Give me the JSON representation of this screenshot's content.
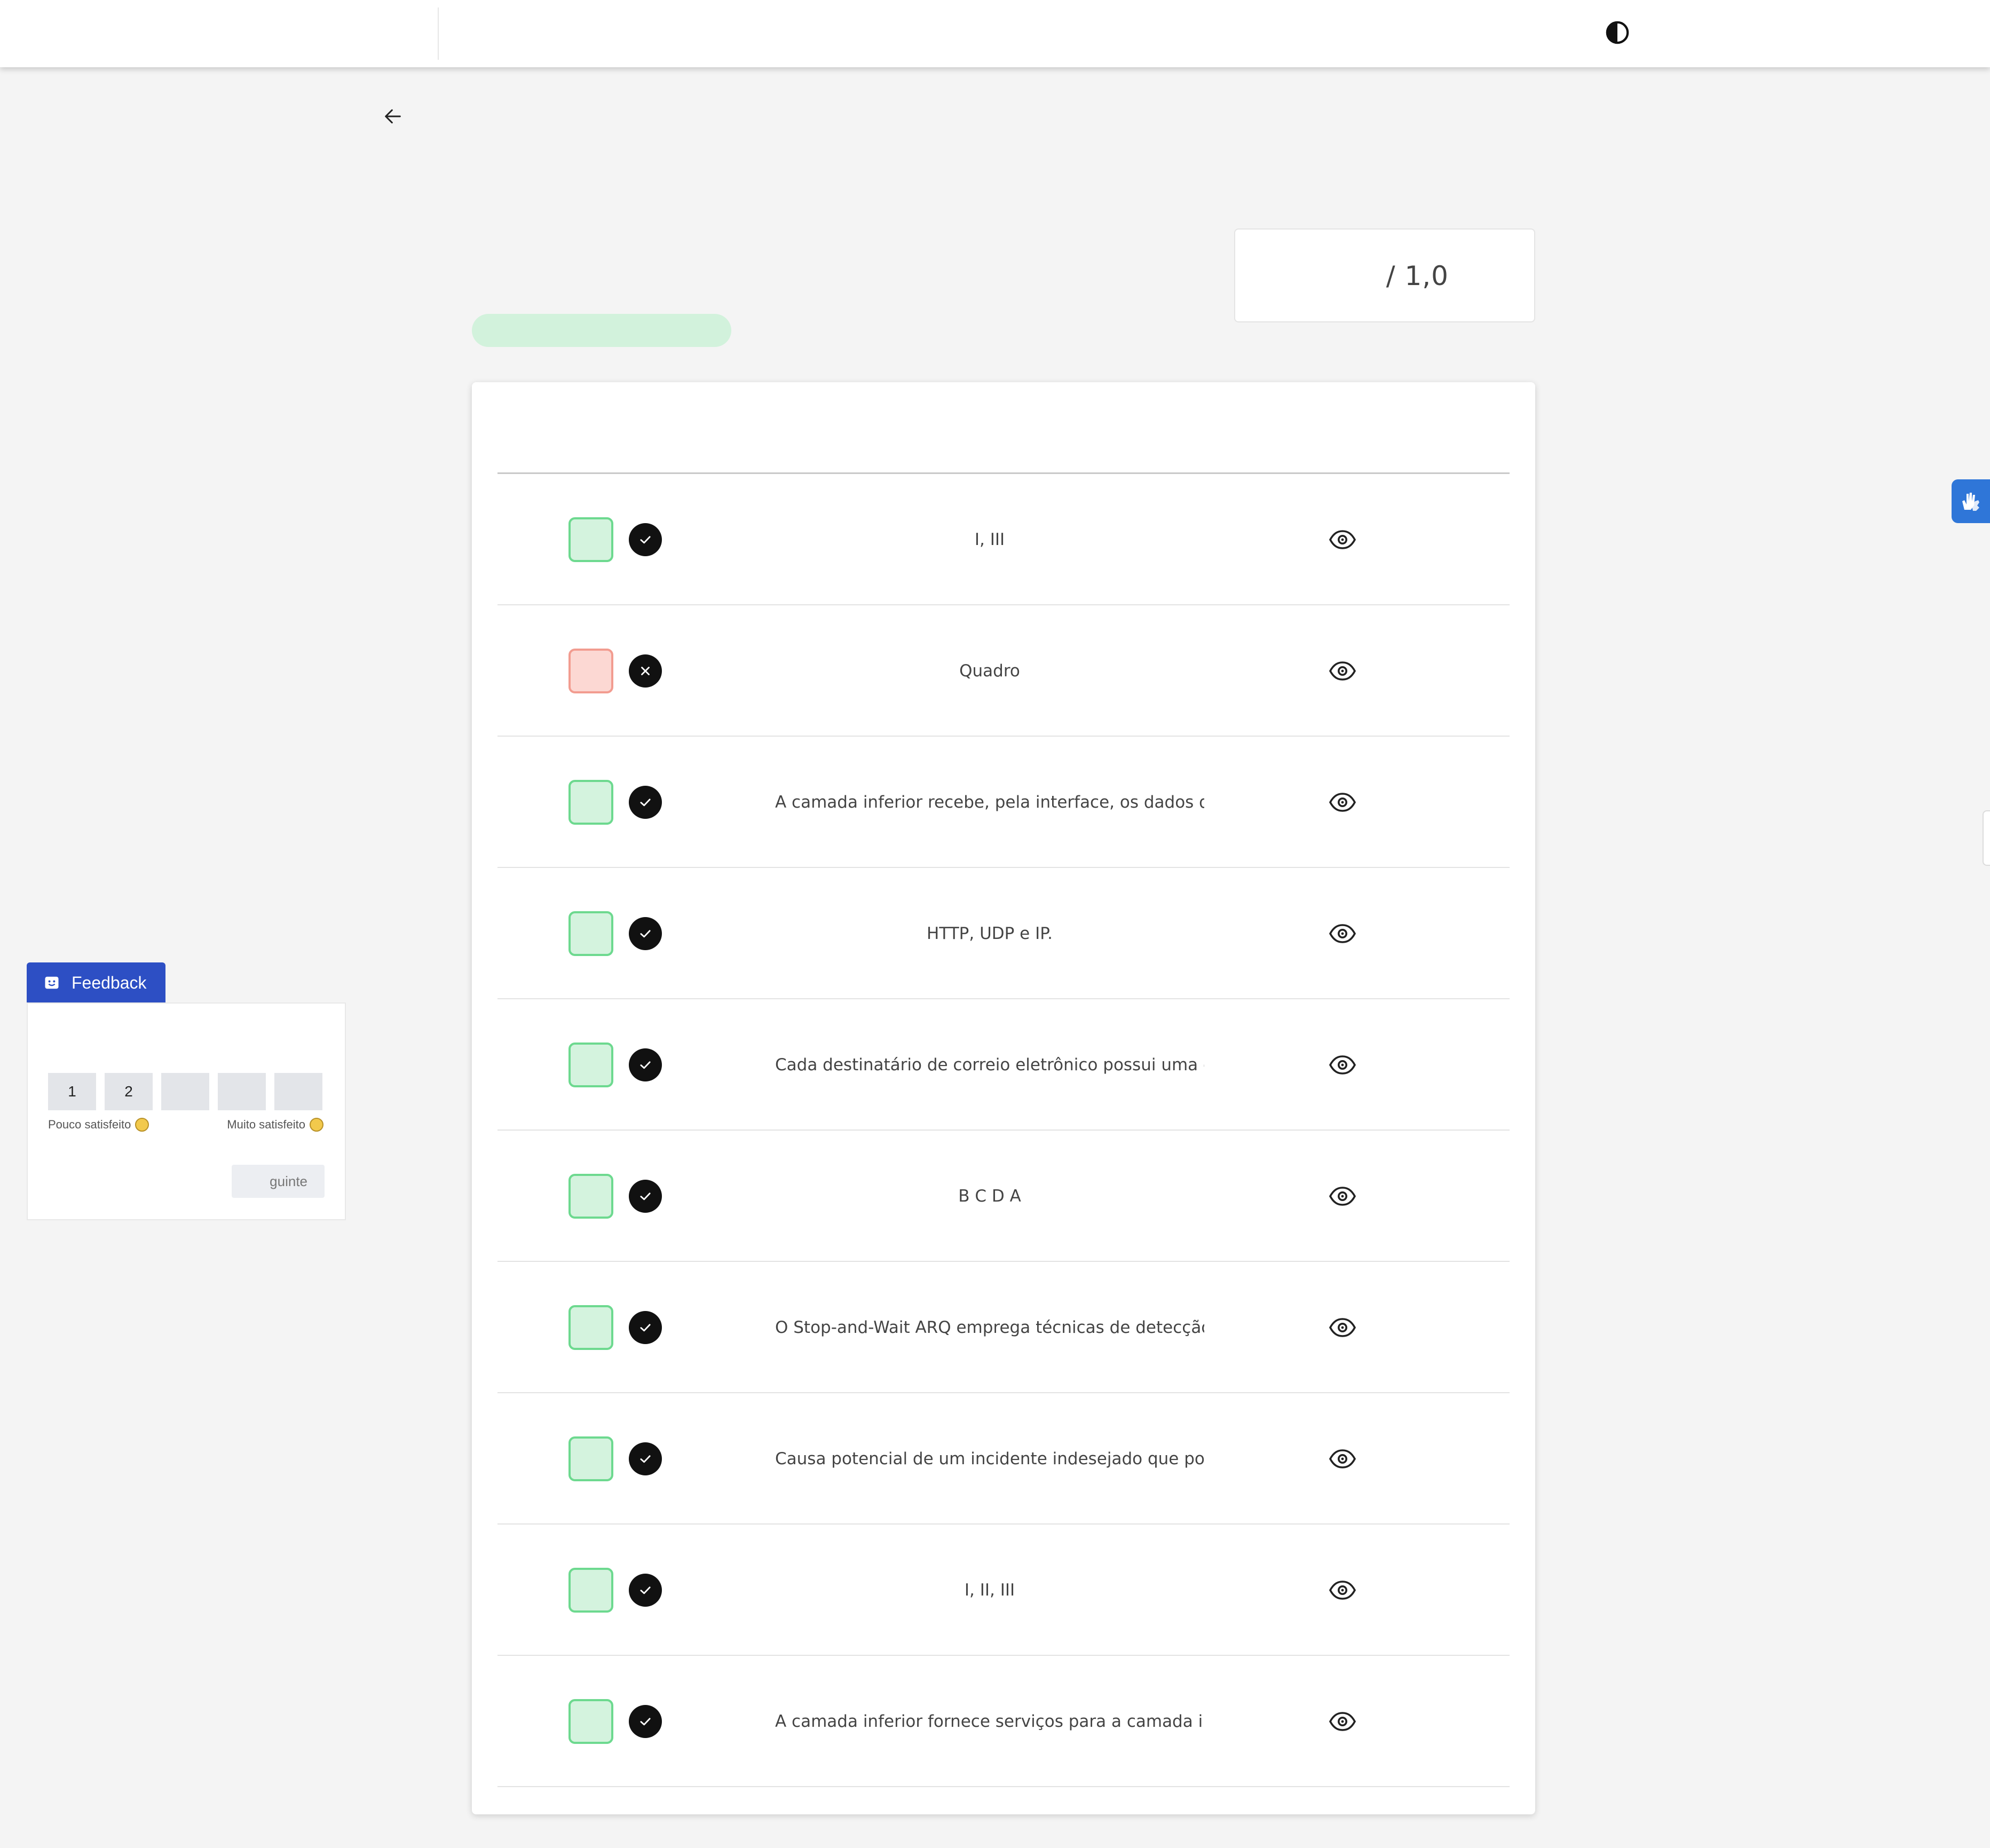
{
  "header": {
    "contrast_icon": "contrast-icon"
  },
  "nav": {
    "back_icon": "arrow-left-icon"
  },
  "score": {
    "total_label": "/ 1,0"
  },
  "colors": {
    "correct_border": "#6dd98f",
    "correct_fill": "#d4f3de",
    "wrong_border": "#f29c90",
    "wrong_fill": "#fcd8d3",
    "status_pill": "#d2f2dc",
    "feedback_blue": "#2d4fc4",
    "accessibility_blue": "#2f76d8"
  },
  "answers": [
    {
      "status": "correct",
      "status_icon": "check-icon",
      "text": "I, III",
      "align": "center",
      "view_icon": "eye-icon"
    },
    {
      "status": "wrong",
      "status_icon": "x-icon",
      "text": "Quadro",
      "align": "center",
      "view_icon": "eye-icon"
    },
    {
      "status": "correct",
      "status_icon": "check-icon",
      "text": "A camada inferior recebe, pela interface, os dados da",
      "align": "left",
      "view_icon": "eye-icon"
    },
    {
      "status": "correct",
      "status_icon": "check-icon",
      "text": "HTTP, UDP e IP.",
      "align": "center",
      "view_icon": "eye-icon"
    },
    {
      "status": "correct",
      "status_icon": "check-icon",
      "text": "Cada destinatário de correio eletrônico possui uma ca",
      "align": "left",
      "view_icon": "eye-icon"
    },
    {
      "status": "correct",
      "status_icon": "check-icon",
      "text": "B C D A",
      "align": "center",
      "view_icon": "eye-icon"
    },
    {
      "status": "correct",
      "status_icon": "check-icon",
      "text": "O Stop-and-Wait ARQ emprega técnicas de detecção",
      "align": "left",
      "view_icon": "eye-icon"
    },
    {
      "status": "correct",
      "status_icon": "check-icon",
      "text": "Causa potencial de um incidente indesejado que pod",
      "align": "left",
      "view_icon": "eye-icon"
    },
    {
      "status": "correct",
      "status_icon": "check-icon",
      "text": "I, II, III",
      "align": "center",
      "view_icon": "eye-icon"
    },
    {
      "status": "correct",
      "status_icon": "check-icon",
      "text": "A camada inferior fornece serviços para a camada im",
      "align": "left",
      "view_icon": "eye-icon"
    }
  ],
  "feedback": {
    "tab_label": "Feedback",
    "tab_icon": "smile-box-icon",
    "scale": [
      "1",
      "2",
      "",
      "",
      ""
    ],
    "low_label": "Pouco satisfeito",
    "high_label": "Muito satisfeito",
    "next_label": "guinte"
  },
  "accessibility": {
    "icon": "sign-language-hands-icon"
  }
}
